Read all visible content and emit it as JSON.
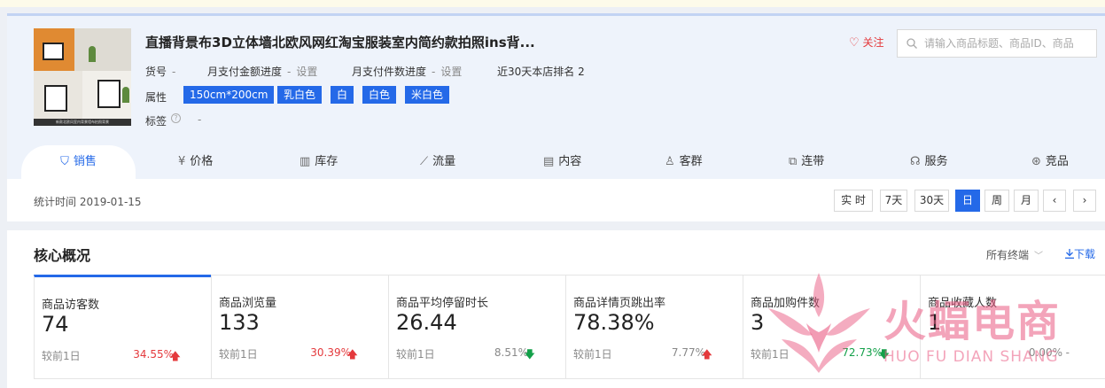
{
  "product": {
    "title": "直播背景布3D立体墙北欧风网红淘宝服装室内简约款拍照ins背...",
    "thumbnail_caption": "新款北欧风室内背景墙布拍照背景",
    "item_no_label": "货号",
    "item_no_value": "-",
    "monthly_amount_label": "月支付金额进度",
    "monthly_amount_value": "-",
    "monthly_amount_link": "设置",
    "monthly_count_label": "月支付件数进度",
    "monthly_count_value": "-",
    "monthly_count_link": "设置",
    "rank_text": "近30天本店排名 2",
    "attr_label": "属性",
    "attrs": [
      "150cm*200cm",
      "乳白色",
      "白",
      "白色",
      "米白色"
    ],
    "tag_label": "标签",
    "tag_help": "?",
    "tag_value": "-",
    "follow_label": "关注"
  },
  "search": {
    "placeholder": "请输入商品标题、商品ID、商品"
  },
  "tabs": [
    {
      "label": "销售",
      "icon": "bag-icon",
      "active": true
    },
    {
      "label": "价格",
      "icon": "yuan-icon"
    },
    {
      "label": "库存",
      "icon": "warehouse-icon"
    },
    {
      "label": "流量",
      "icon": "trend-icon"
    },
    {
      "label": "内容",
      "icon": "document-icon"
    },
    {
      "label": "客群",
      "icon": "users-icon"
    },
    {
      "label": "连带",
      "icon": "link-icon"
    },
    {
      "label": "服务",
      "icon": "headset-icon"
    },
    {
      "label": "竞品",
      "icon": "vs-icon"
    }
  ],
  "stat": {
    "label": "统计时间 2019-01-15",
    "periods": [
      "实 时",
      "7天",
      "30天",
      "日",
      "周",
      "月"
    ],
    "active_period": "日",
    "prev": "‹",
    "next": "›"
  },
  "core": {
    "title": "核心概况",
    "terminal": "所有终端",
    "download": "下载",
    "metrics": [
      {
        "name": "商品访客数",
        "value": "74",
        "compare": "较前1日",
        "pct": "34.55%",
        "trend": "up"
      },
      {
        "name": "商品浏览量",
        "value": "133",
        "compare": "较前1日",
        "pct": "30.39%",
        "trend": "up"
      },
      {
        "name": "商品平均停留时长",
        "value": "26.44",
        "compare": "较前1日",
        "pct": "8.51%",
        "trend": "down"
      },
      {
        "name": "商品详情页跳出率",
        "value": "78.38%",
        "compare": "较前1日",
        "pct": "7.77%",
        "trend": "up"
      },
      {
        "name": "商品加购件数",
        "value": "3",
        "compare": "较前1日",
        "pct": "72.73%",
        "trend": "down"
      },
      {
        "name": "商品收藏人数",
        "value": "1",
        "compare": "",
        "pct": "0.00%",
        "trend": "flat"
      }
    ]
  },
  "watermark": {
    "cn": "火蝠电商",
    "en": "HUO FU DIAN SHANG"
  },
  "colors": {
    "accent": "#2469e8",
    "up": "#e4393c",
    "down": "#13a049",
    "watermark": "#e95a82"
  }
}
